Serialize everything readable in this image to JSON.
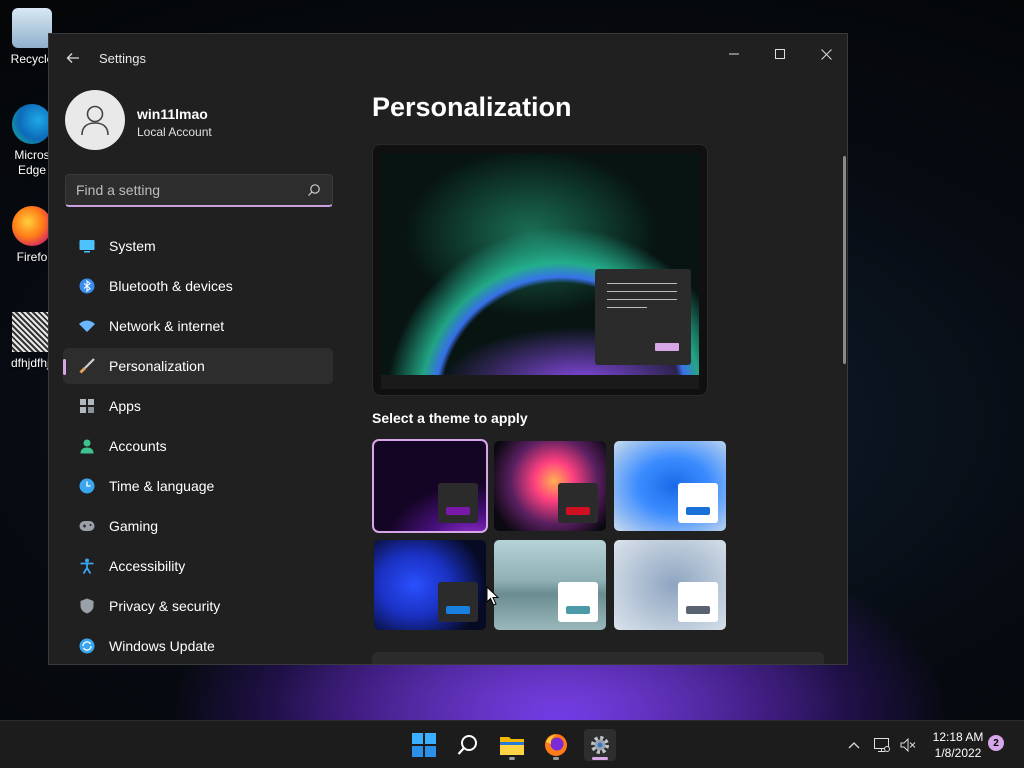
{
  "desktop": {
    "icons": [
      {
        "label": "Recycle",
        "icon": "recycle-bin-icon"
      },
      {
        "label": "Micros Edge",
        "icon": "edge-icon"
      },
      {
        "label": "Firefo",
        "icon": "firefox-icon"
      },
      {
        "label": "dfhjdfhjf",
        "icon": "image-file-icon"
      }
    ]
  },
  "window": {
    "title": "Settings",
    "back_icon": "back-arrow-icon",
    "controls": [
      "minimize-icon",
      "maximize-icon",
      "close-icon"
    ]
  },
  "profile": {
    "name": "win11lmao",
    "account_type": "Local Account"
  },
  "search": {
    "placeholder": "Find a setting",
    "value": ""
  },
  "nav": {
    "items": [
      {
        "label": "System",
        "icon": "monitor-icon",
        "color": "#4cc2ff"
      },
      {
        "label": "Bluetooth & devices",
        "icon": "bluetooth-icon",
        "color": "#3a8ef0"
      },
      {
        "label": "Network & internet",
        "icon": "wifi-icon",
        "color": "#6ab7ff"
      },
      {
        "label": "Personalization",
        "icon": "brush-icon",
        "color": "#e0a060",
        "active": true
      },
      {
        "label": "Apps",
        "icon": "apps-grid-icon",
        "color": "#b0b8c0"
      },
      {
        "label": "Accounts",
        "icon": "person-icon",
        "color": "#3ec28f"
      },
      {
        "label": "Time & language",
        "icon": "globe-clock-icon",
        "color": "#3aa6f0"
      },
      {
        "label": "Gaming",
        "icon": "gamepad-icon",
        "color": "#9aa0a8"
      },
      {
        "label": "Accessibility",
        "icon": "accessibility-icon",
        "color": "#3aa6f0"
      },
      {
        "label": "Privacy & security",
        "icon": "shield-icon",
        "color": "#9aa0a8"
      },
      {
        "label": "Windows Update",
        "icon": "sync-icon",
        "color": "#3aa6f0"
      }
    ]
  },
  "main": {
    "title": "Personalization",
    "section_label": "Select a theme to apply",
    "themes": [
      {
        "name": "theme-glow-dark",
        "accent": "#7a18a8",
        "chip": "#2b2b2b",
        "selected": true
      },
      {
        "name": "theme-flower",
        "accent": "#d01020",
        "chip": "#2b2b2b"
      },
      {
        "name": "theme-bloom-light",
        "accent": "#1a70d8",
        "chip": "#ffffff"
      },
      {
        "name": "theme-bloom-dark",
        "accent": "#1a80e0",
        "chip": "#2b2b2b"
      },
      {
        "name": "theme-lake",
        "accent": "#4a9aa8",
        "chip": "#ffffff"
      },
      {
        "name": "theme-sculpture",
        "accent": "#5a6470",
        "chip": "#ffffff"
      }
    ]
  },
  "colors": {
    "accent": "#d7a6e8",
    "window_bg": "#202020",
    "panel_bg": "#2d2d2d"
  },
  "taskbar": {
    "apps": [
      "start-icon",
      "search-icon",
      "file-explorer-icon",
      "firefox-icon",
      "settings-gear-icon"
    ],
    "time": "12:18 AM",
    "date": "1/8/2022",
    "notifications": "2"
  }
}
